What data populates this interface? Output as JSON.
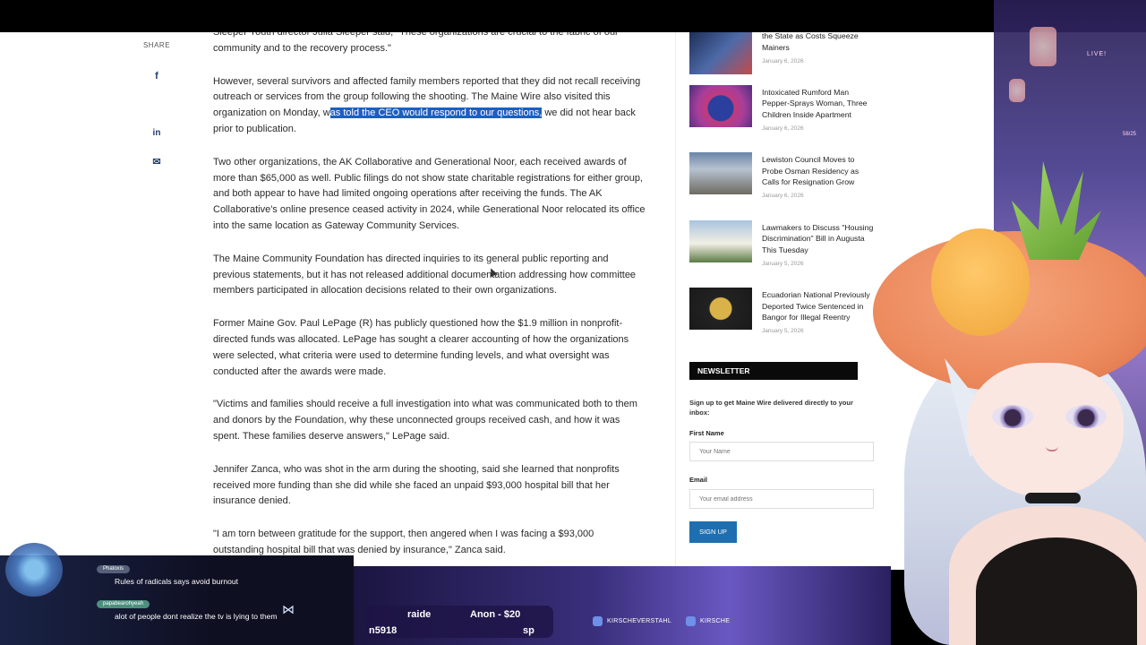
{
  "share": {
    "label": "SHARE",
    "facebook_glyph": "f",
    "linkedin_glyph": "in",
    "email_glyph": "✉"
  },
  "article": {
    "p0": "Sleeper Youth director Julia Sleeper said, \"These organizations are crucial to the fabric of our community and to the recovery process.\"",
    "p1_before": "However, several survivors and affected family members reported that they did not recall receiving outreach or services from the group following the shooting. The Maine Wire also visited this organization on Monday, w",
    "p1_selected": "as told the CEO would respond to our questions,",
    "p1_after": " we did not hear back prior to publication.",
    "p2": "Two other organizations, the AK Collaborative and Generational Noor, each received awards of more than $65,000 as well. Public filings do not show state charitable registrations for either group, and both appear to have had limited ongoing operations after receiving the funds. The AK Collaborative's online presence ceased activity in 2024, while Generational Noor relocated its office into the same location as Gateway Community Services.",
    "p3": "The Maine Community Foundation has directed inquiries to its general public reporting and previous statements, but it has not released additional documentation addressing how committee members participated in allocation decisions related to their own organizations.",
    "p4": "Former Maine Gov. Paul LePage (R) has publicly questioned how the $1.9 million in nonprofit-directed funds was allocated. LePage has sought a clearer accounting of how the organizations were selected, what criteria were used to determine funding levels, and what oversight was conducted after the awards were made.",
    "p5": "\"Victims and families should receive a full investigation into what was communicated both to them and donors by the Foundation, why these unconnected groups received cash, and how it was spent. These families deserve answers,\" LePage said.",
    "p6": "Jennifer Zanca, who was shot in the arm during the shooting, said she learned that nonprofits received more funding than she did while she faced an unpaid $93,000 hospital bill that her insurance denied.",
    "p7": "\"I am torn between gratitude for the support, then angered when I was facing a $93,000 outstanding hospital bill that was denied by insurance,\" Zanca said."
  },
  "sidebar": {
    "news": [
      {
        "title": "the State as Costs Squeeze Mainers",
        "date": "January 6, 2026"
      },
      {
        "title": "Intoxicated Rumford Man Pepper-Sprays Woman, Three Children Inside Apartment",
        "date": "January 6, 2026"
      },
      {
        "title": "Lewiston Council Moves to Probe Osman Residency as Calls for Resignation Grow",
        "date": "January 6, 2026"
      },
      {
        "title": "Lawmakers to Discuss \"Housing Discrimination\" Bill in Augusta This Tuesday",
        "date": "January 5, 2026"
      },
      {
        "title": "Ecuadorian National Previously Deported Twice Sentenced in Bangor for Illegal Reentry",
        "date": "January 5, 2026"
      }
    ],
    "newsletter": {
      "heading": "NEWSLETTER",
      "text": "Sign up to get Maine Wire delivered directly to your inbox:",
      "first_name_label": "First Name",
      "first_name_placeholder": "Your Name",
      "email_label": "Email",
      "email_placeholder": "Your email address",
      "signup_label": "SIGN UP"
    }
  },
  "overlay": {
    "live_label": "LIVE!",
    "viewer_count": "58/25",
    "chat": [
      {
        "user": "Phatoxis",
        "message": "Rules of radicals says avoid burnout"
      },
      {
        "user": "papabearohyeah",
        "message": "alot of people dont realize the tv is lying to them"
      }
    ],
    "ticker": {
      "item1": "raide",
      "item2": "Anon - $20",
      "item3": "n5918",
      "item4": "sp"
    },
    "social": {
      "twitter": "KIRSCHEVERSTAHL",
      "discord": "KIRSCHE"
    }
  }
}
